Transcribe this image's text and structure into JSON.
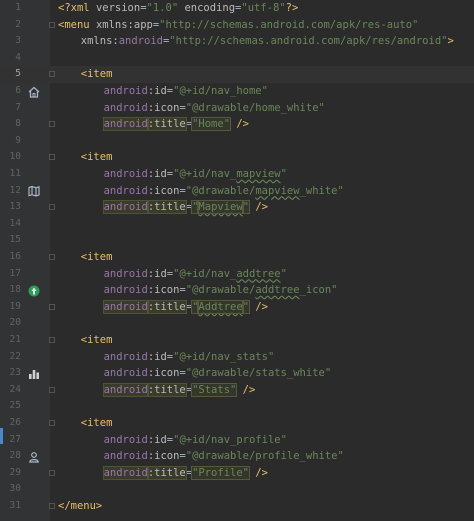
{
  "editor": {
    "language": "XML",
    "current_line": 5,
    "lines": [
      {
        "n": "1",
        "indent": 0,
        "tokens": [
          {
            "t": "tag",
            "v": "<?xml "
          },
          {
            "t": "attr",
            "v": "version"
          },
          {
            "t": "plain",
            "v": "="
          },
          {
            "t": "str",
            "v": "\"1.0\" "
          },
          {
            "t": "attr",
            "v": "encoding"
          },
          {
            "t": "plain",
            "v": "="
          },
          {
            "t": "str",
            "v": "\"utf-8\""
          },
          {
            "t": "tag",
            "v": "?>"
          }
        ]
      },
      {
        "n": "2",
        "indent": 0,
        "tokens": [
          {
            "t": "tag",
            "v": "<menu "
          },
          {
            "t": "attr",
            "v": "xmlns:app"
          },
          {
            "t": "plain",
            "v": "="
          },
          {
            "t": "str",
            "v": "\"http://schemas.android.com/apk/res-auto\""
          }
        ]
      },
      {
        "n": "3",
        "indent": 3,
        "tokens": [
          {
            "t": "attr",
            "v": "xmlns:"
          },
          {
            "t": "ns",
            "v": "android"
          },
          {
            "t": "plain",
            "v": "="
          },
          {
            "t": "str",
            "v": "\"http://schemas.android.com/apk/res/android\""
          },
          {
            "t": "tag",
            "v": ">"
          }
        ]
      },
      {
        "n": "4",
        "indent": 0,
        "tokens": []
      },
      {
        "n": "5",
        "indent": 3,
        "tokens": [
          {
            "t": "tag",
            "v": "<item"
          }
        ]
      },
      {
        "n": "6",
        "indent": 6,
        "tokens": [
          {
            "t": "ns",
            "v": "android"
          },
          {
            "t": "attr",
            "v": ":id"
          },
          {
            "t": "plain",
            "v": "="
          },
          {
            "t": "str",
            "v": "\"@+id/nav_home\""
          }
        ]
      },
      {
        "n": "7",
        "indent": 6,
        "tokens": [
          {
            "t": "ns",
            "v": "android"
          },
          {
            "t": "attr",
            "v": ":icon"
          },
          {
            "t": "plain",
            "v": "="
          },
          {
            "t": "str",
            "v": "\"@drawable/home_white\""
          }
        ]
      },
      {
        "n": "8",
        "indent": 6,
        "tokens": [
          {
            "t": "ns",
            "v": "android",
            "h": true
          },
          {
            "t": "attr",
            "v": ":title",
            "h": true
          },
          {
            "t": "plain",
            "v": "="
          },
          {
            "t": "str",
            "v": "\"Home\"",
            "box": true
          },
          {
            "t": "tag",
            "v": " />"
          }
        ]
      },
      {
        "n": "9",
        "indent": 0,
        "tokens": []
      },
      {
        "n": "10",
        "indent": 3,
        "tokens": [
          {
            "t": "tag",
            "v": "<item"
          }
        ]
      },
      {
        "n": "11",
        "indent": 6,
        "tokens": [
          {
            "t": "ns",
            "v": "android"
          },
          {
            "t": "attr",
            "v": ":id"
          },
          {
            "t": "plain",
            "v": "="
          },
          {
            "t": "str",
            "v": "\"@+id/nav_"
          },
          {
            "t": "str",
            "v": "mapview",
            "w": true
          },
          {
            "t": "str",
            "v": "\""
          }
        ]
      },
      {
        "n": "12",
        "indent": 6,
        "tokens": [
          {
            "t": "ns",
            "v": "android"
          },
          {
            "t": "attr",
            "v": ":icon"
          },
          {
            "t": "plain",
            "v": "="
          },
          {
            "t": "str",
            "v": "\"@drawable/"
          },
          {
            "t": "str",
            "v": "mapview",
            "w": true
          },
          {
            "t": "str",
            "v": "_white\""
          }
        ]
      },
      {
        "n": "13",
        "indent": 6,
        "tokens": [
          {
            "t": "ns",
            "v": "android",
            "h": true
          },
          {
            "t": "attr",
            "v": ":title",
            "h": true
          },
          {
            "t": "plain",
            "v": "="
          },
          {
            "t": "str",
            "v": "\"",
            "box": true
          },
          {
            "t": "str",
            "v": "Mapview",
            "w": true,
            "box": true
          },
          {
            "t": "str",
            "v": "\"",
            "box": true
          },
          {
            "t": "tag",
            "v": " />"
          }
        ]
      },
      {
        "n": "14",
        "indent": 0,
        "tokens": []
      },
      {
        "n": "15",
        "indent": 0,
        "tokens": []
      },
      {
        "n": "16",
        "indent": 3,
        "tokens": [
          {
            "t": "tag",
            "v": "<item"
          }
        ]
      },
      {
        "n": "17",
        "indent": 6,
        "tokens": [
          {
            "t": "ns",
            "v": "android"
          },
          {
            "t": "attr",
            "v": ":id"
          },
          {
            "t": "plain",
            "v": "="
          },
          {
            "t": "str",
            "v": "\"@+id/nav_"
          },
          {
            "t": "str",
            "v": "addtree",
            "w": true
          },
          {
            "t": "str",
            "v": "\""
          }
        ]
      },
      {
        "n": "18",
        "indent": 6,
        "tokens": [
          {
            "t": "ns",
            "v": "android"
          },
          {
            "t": "attr",
            "v": ":icon"
          },
          {
            "t": "plain",
            "v": "="
          },
          {
            "t": "str",
            "v": "\"@drawable/"
          },
          {
            "t": "str",
            "v": "addtree",
            "w": true
          },
          {
            "t": "str",
            "v": "_icon\""
          }
        ]
      },
      {
        "n": "19",
        "indent": 6,
        "tokens": [
          {
            "t": "ns",
            "v": "android",
            "h": true
          },
          {
            "t": "attr",
            "v": ":title",
            "h": true
          },
          {
            "t": "plain",
            "v": "="
          },
          {
            "t": "str",
            "v": "\"",
            "box": true
          },
          {
            "t": "str",
            "v": "Addtree",
            "w": true,
            "box": true
          },
          {
            "t": "str",
            "v": "\"",
            "box": true
          },
          {
            "t": "tag",
            "v": " />"
          }
        ]
      },
      {
        "n": "20",
        "indent": 0,
        "tokens": []
      },
      {
        "n": "21",
        "indent": 3,
        "tokens": [
          {
            "t": "tag",
            "v": "<item"
          }
        ]
      },
      {
        "n": "22",
        "indent": 6,
        "tokens": [
          {
            "t": "ns",
            "v": "android"
          },
          {
            "t": "attr",
            "v": ":id"
          },
          {
            "t": "plain",
            "v": "="
          },
          {
            "t": "str",
            "v": "\"@+id/nav_stats\""
          }
        ]
      },
      {
        "n": "23",
        "indent": 6,
        "tokens": [
          {
            "t": "ns",
            "v": "android"
          },
          {
            "t": "attr",
            "v": ":icon"
          },
          {
            "t": "plain",
            "v": "="
          },
          {
            "t": "str",
            "v": "\"@drawable/stats_white\""
          }
        ]
      },
      {
        "n": "24",
        "indent": 6,
        "tokens": [
          {
            "t": "ns",
            "v": "android",
            "h": true
          },
          {
            "t": "attr",
            "v": ":title",
            "h": true
          },
          {
            "t": "plain",
            "v": "="
          },
          {
            "t": "str",
            "v": "\"Stats\"",
            "box": true
          },
          {
            "t": "tag",
            "v": " />"
          }
        ]
      },
      {
        "n": "25",
        "indent": 0,
        "tokens": []
      },
      {
        "n": "26",
        "indent": 3,
        "tokens": [
          {
            "t": "tag",
            "v": "<item"
          }
        ]
      },
      {
        "n": "27",
        "indent": 6,
        "tokens": [
          {
            "t": "ns",
            "v": "android"
          },
          {
            "t": "attr",
            "v": ":id"
          },
          {
            "t": "plain",
            "v": "="
          },
          {
            "t": "str",
            "v": "\"@+id/nav_profile\""
          }
        ]
      },
      {
        "n": "28",
        "indent": 6,
        "tokens": [
          {
            "t": "ns",
            "v": "android"
          },
          {
            "t": "attr",
            "v": ":icon"
          },
          {
            "t": "plain",
            "v": "="
          },
          {
            "t": "str",
            "v": "\"@drawable/profile_white\""
          }
        ]
      },
      {
        "n": "29",
        "indent": 6,
        "tokens": [
          {
            "t": "ns",
            "v": "android",
            "h": true
          },
          {
            "t": "attr",
            "v": ":title",
            "h": true
          },
          {
            "t": "plain",
            "v": "="
          },
          {
            "t": "str",
            "v": "\"Profile\"",
            "box": true
          },
          {
            "t": "tag",
            "v": " />"
          }
        ]
      },
      {
        "n": "30",
        "indent": 0,
        "tokens": []
      },
      {
        "n": "31",
        "indent": 0,
        "tokens": [
          {
            "t": "tag",
            "v": "</menu>"
          }
        ]
      }
    ],
    "gutter_icons": [
      {
        "line": "6",
        "icon": "home-icon",
        "color": "#a9b7c6"
      },
      {
        "line": "12",
        "icon": "map-icon",
        "color": "#a9b7c6"
      },
      {
        "line": "18",
        "icon": "addtree-icon",
        "color": "#2e9b57"
      },
      {
        "line": "23",
        "icon": "stats-icon",
        "color": "#d0d0d0"
      },
      {
        "line": "28",
        "icon": "profile-icon",
        "color": "#a9b7c6"
      }
    ],
    "fold_lines": [
      "2",
      "5",
      "8",
      "10",
      "13",
      "16",
      "19",
      "21",
      "24",
      "26",
      "29",
      "31"
    ]
  }
}
